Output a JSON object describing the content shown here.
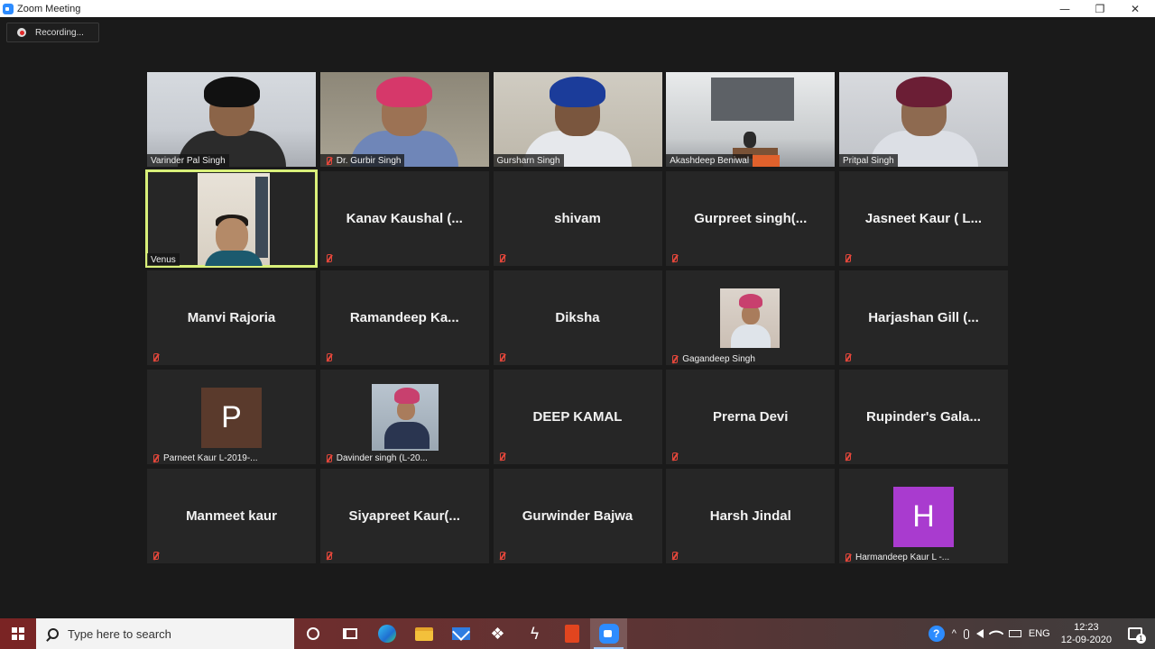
{
  "window": {
    "title": "Zoom Meeting",
    "minimize_glyph": "—",
    "restore_glyph": "❐",
    "close_glyph": "✕"
  },
  "recording": {
    "label": "Recording..."
  },
  "participants": [
    {
      "name": "Varinder Pal Singh",
      "type": "video",
      "muted": false
    },
    {
      "name": "Dr. Gurbir Singh",
      "type": "video",
      "muted": true
    },
    {
      "name": "Gursharn Singh",
      "type": "video",
      "muted": false
    },
    {
      "name": "Akashdeep Beniwal",
      "type": "video",
      "muted": false
    },
    {
      "name": "Pritpal Singh",
      "type": "video",
      "muted": false
    },
    {
      "name": "Venus",
      "type": "video",
      "muted": false,
      "active_speaker": true
    },
    {
      "display": "Kanav  Kaushal  (...",
      "type": "name",
      "muted": true
    },
    {
      "display": "shivam",
      "type": "name",
      "muted": true
    },
    {
      "display": "Gurpreet  singh(...",
      "type": "name",
      "muted": true
    },
    {
      "display": "Jasneet Kaur ( L...",
      "type": "name",
      "muted": true
    },
    {
      "display": "Manvi Rajoria",
      "type": "name",
      "muted": true
    },
    {
      "display": "Ramandeep  Ka...",
      "type": "name",
      "muted": true
    },
    {
      "display": "Diksha",
      "type": "name",
      "muted": true
    },
    {
      "name": "Gagandeep Singh",
      "type": "photo",
      "muted": true
    },
    {
      "display": "Harjashan Gill (...",
      "type": "name",
      "muted": true
    },
    {
      "name": "Parneet Kaur L-2019-...",
      "type": "letter",
      "letter": "P",
      "letter_color": "#5a3a2c",
      "muted": true
    },
    {
      "name": "Davinder singh (L-20...",
      "type": "photo",
      "muted": true
    },
    {
      "display": "DEEP KAMAL",
      "type": "name",
      "muted": true
    },
    {
      "display": "Prerna Devi",
      "type": "name",
      "muted": true
    },
    {
      "display": "Rupinder's Gala...",
      "type": "name",
      "muted": true
    },
    {
      "display": "Manmeet kaur",
      "type": "name",
      "muted": true
    },
    {
      "display": "Siyapreet  Kaur(...",
      "type": "name",
      "muted": true
    },
    {
      "display": "Gurwinder Bajwa",
      "type": "name",
      "muted": true
    },
    {
      "display": "Harsh Jindal",
      "type": "name",
      "muted": true
    },
    {
      "name": "Harmandeep Kaur L -...",
      "type": "letter",
      "letter": "H",
      "letter_color": "#a93bcf",
      "muted": true
    }
  ],
  "colors": {
    "active_speaker_border": "#d9f07a",
    "mute_icon": "#e5473b",
    "zoom_blue": "#2d8cff"
  },
  "taskbar": {
    "search_placeholder": "Type here to search",
    "language": "ENG",
    "time": "12:23",
    "date": "12-09-2020",
    "notification_count": "1",
    "help_glyph": "?",
    "tray_up_glyph": "^",
    "dropbox_glyph": "❖",
    "bolt_glyph": "ϟ"
  }
}
